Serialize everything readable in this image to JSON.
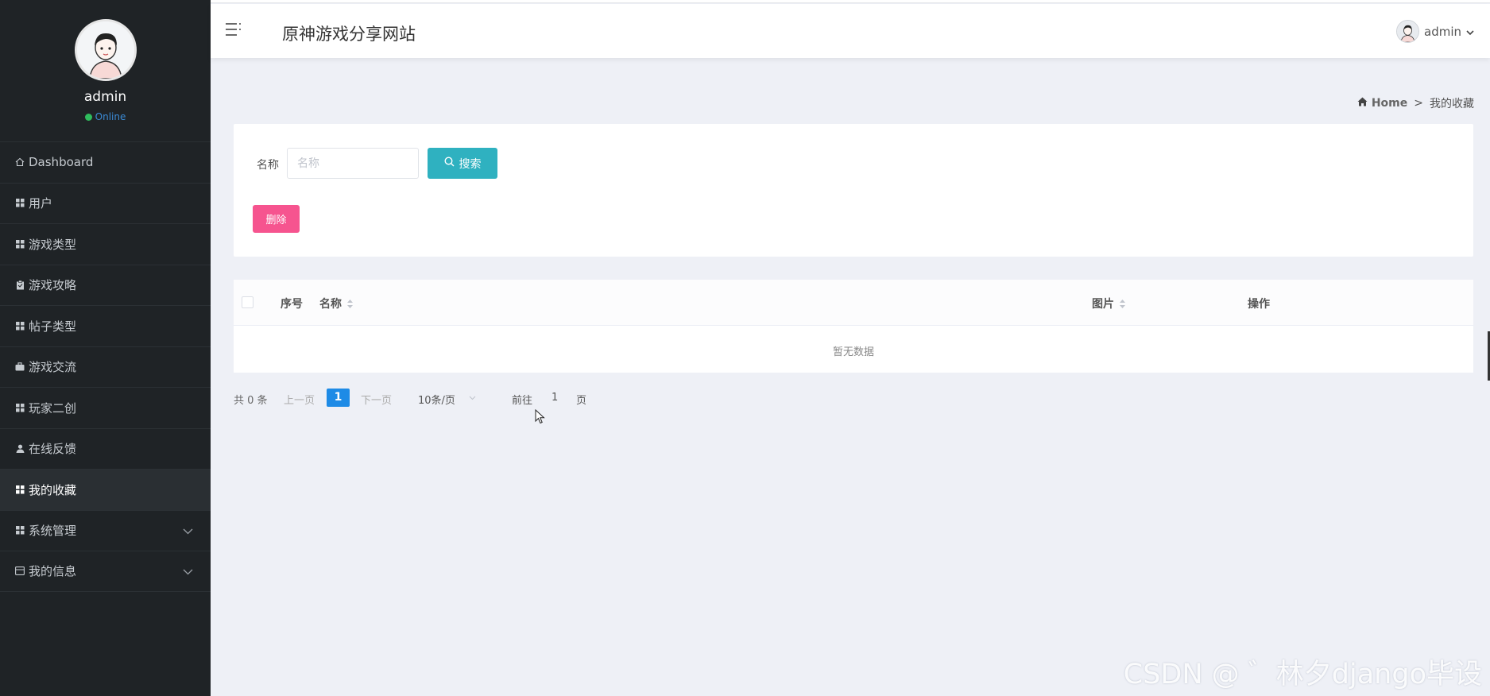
{
  "profile": {
    "name": "admin",
    "status": "Online"
  },
  "sidebar": {
    "items": [
      {
        "label": "Dashboard",
        "icon": "home-icon"
      },
      {
        "label": "用户",
        "icon": "grid-icon"
      },
      {
        "label": "游戏类型",
        "icon": "grid-icon"
      },
      {
        "label": "游戏攻略",
        "icon": "clipboard-icon"
      },
      {
        "label": "帖子类型",
        "icon": "grid-icon"
      },
      {
        "label": "游戏交流",
        "icon": "briefcase-icon"
      },
      {
        "label": "玩家二创",
        "icon": "grid-icon"
      },
      {
        "label": "在线反馈",
        "icon": "user-icon"
      },
      {
        "label": "我的收藏",
        "icon": "grid-icon",
        "active": true
      },
      {
        "label": "系统管理",
        "icon": "grid-icon",
        "expandable": true
      },
      {
        "label": "我的信息",
        "icon": "card-icon",
        "expandable": true
      }
    ]
  },
  "header": {
    "title": "原神游戏分享网站",
    "user": "admin"
  },
  "breadcrumb": {
    "home": "Home",
    "separator": ">",
    "current": "我的收藏"
  },
  "search": {
    "label": "名称",
    "placeholder": "名称",
    "button": "搜索"
  },
  "actions": {
    "delete": "删除"
  },
  "table": {
    "columns": {
      "index": "序号",
      "name": "名称",
      "image": "图片",
      "actions": "操作"
    },
    "empty": "暂无数据"
  },
  "pagination": {
    "total": "共 0 条",
    "prev": "上一页",
    "page": "1",
    "next": "下一页",
    "page_size": "10条/页",
    "goto": "前往",
    "goto_value": "1",
    "goto_unit": "页"
  },
  "watermark": "CSDN @ ゛林夕django毕设",
  "colors": {
    "sidebar_bg": "#1f2326",
    "search_button": "#2fb1c0",
    "delete_button": "#f6548f",
    "active_page": "#1e8be6",
    "online_dot": "#2fbd5d"
  }
}
